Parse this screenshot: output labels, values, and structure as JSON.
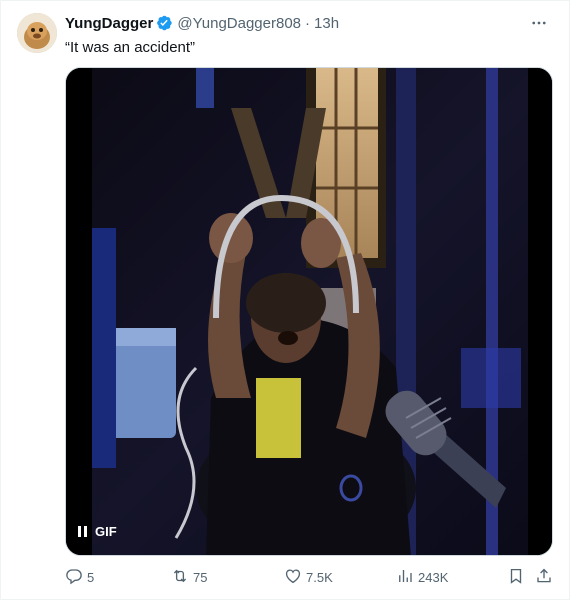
{
  "tweet": {
    "author_name": "YungDagger",
    "handle": "@YungDagger808",
    "separator": "·",
    "time": "13h",
    "text": "“It was an accident”",
    "media_badge": "GIF",
    "stats": {
      "replies": "5",
      "retweets": "75",
      "likes": "7.5K",
      "views": "243K"
    }
  },
  "colors": {
    "verified": "#1d9bf0",
    "secondary_text": "#536471",
    "primary_text": "#0f1419"
  },
  "icons": [
    "verified-badge-icon",
    "more-icon",
    "pause-icon",
    "reply-icon",
    "retweet-icon",
    "like-icon",
    "views-icon",
    "bookmark-icon",
    "share-icon"
  ]
}
